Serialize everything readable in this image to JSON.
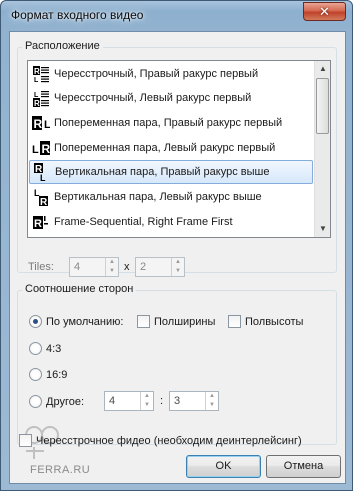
{
  "window": {
    "title": "Формат входного видео",
    "close_glyph": "✕"
  },
  "layout_group": {
    "label": "Расположение",
    "items": [
      {
        "label": "Чересстрочный, Правый ракурс первый",
        "icon": "interlaced-right-first-icon"
      },
      {
        "label": "Чересстрочный, Левый ракурс первый",
        "icon": "interlaced-left-first-icon"
      },
      {
        "label": "Попеременная пара, Правый ракурс первый",
        "icon": "alternating-right-first-icon",
        "glyph_a": "R",
        "glyph_b": "L"
      },
      {
        "label": "Попеременная пара, Левый ракурс первый",
        "icon": "alternating-left-first-icon",
        "glyph_a": "L",
        "glyph_b": "R"
      },
      {
        "label": "Вертикальная пара, Правый ракурс выше",
        "icon": "vertical-right-above-icon",
        "glyph_a": "R",
        "glyph_b": "L"
      },
      {
        "label": "Вертикальная пара, Левый ракурс выше",
        "icon": "vertical-left-above-icon",
        "glyph_a": "L",
        "glyph_b": "R"
      },
      {
        "label": "Frame-Sequential, Right Frame First",
        "icon": "frame-sequential-icon",
        "glyph_a": "R"
      }
    ],
    "selected_index": 4,
    "tiles_label": "Tiles:",
    "tiles_x": "4",
    "tiles_sep": "x",
    "tiles_y": "2"
  },
  "aspect_group": {
    "label": "Соотношение сторон",
    "default_label": "По умолчанию:",
    "half_width_label": "Полширины",
    "half_height_label": "Полвысоты",
    "ratio_4_3": "4:3",
    "ratio_16_9": "16:9",
    "other_label": "Другое:",
    "other_w": "4",
    "other_sep": ":",
    "other_h": "3",
    "selected": "default"
  },
  "interlaced_checkbox_label": "Чересстрочное фидео (необходим деинтерлейсинг)",
  "buttons": {
    "ok": "OK",
    "cancel": "Отмена"
  },
  "watermark_text": "FERRA.RU",
  "colors": {
    "selection_border": "#84acdd",
    "title_bar": "#92b2cf",
    "close_button": "#c0422a"
  }
}
